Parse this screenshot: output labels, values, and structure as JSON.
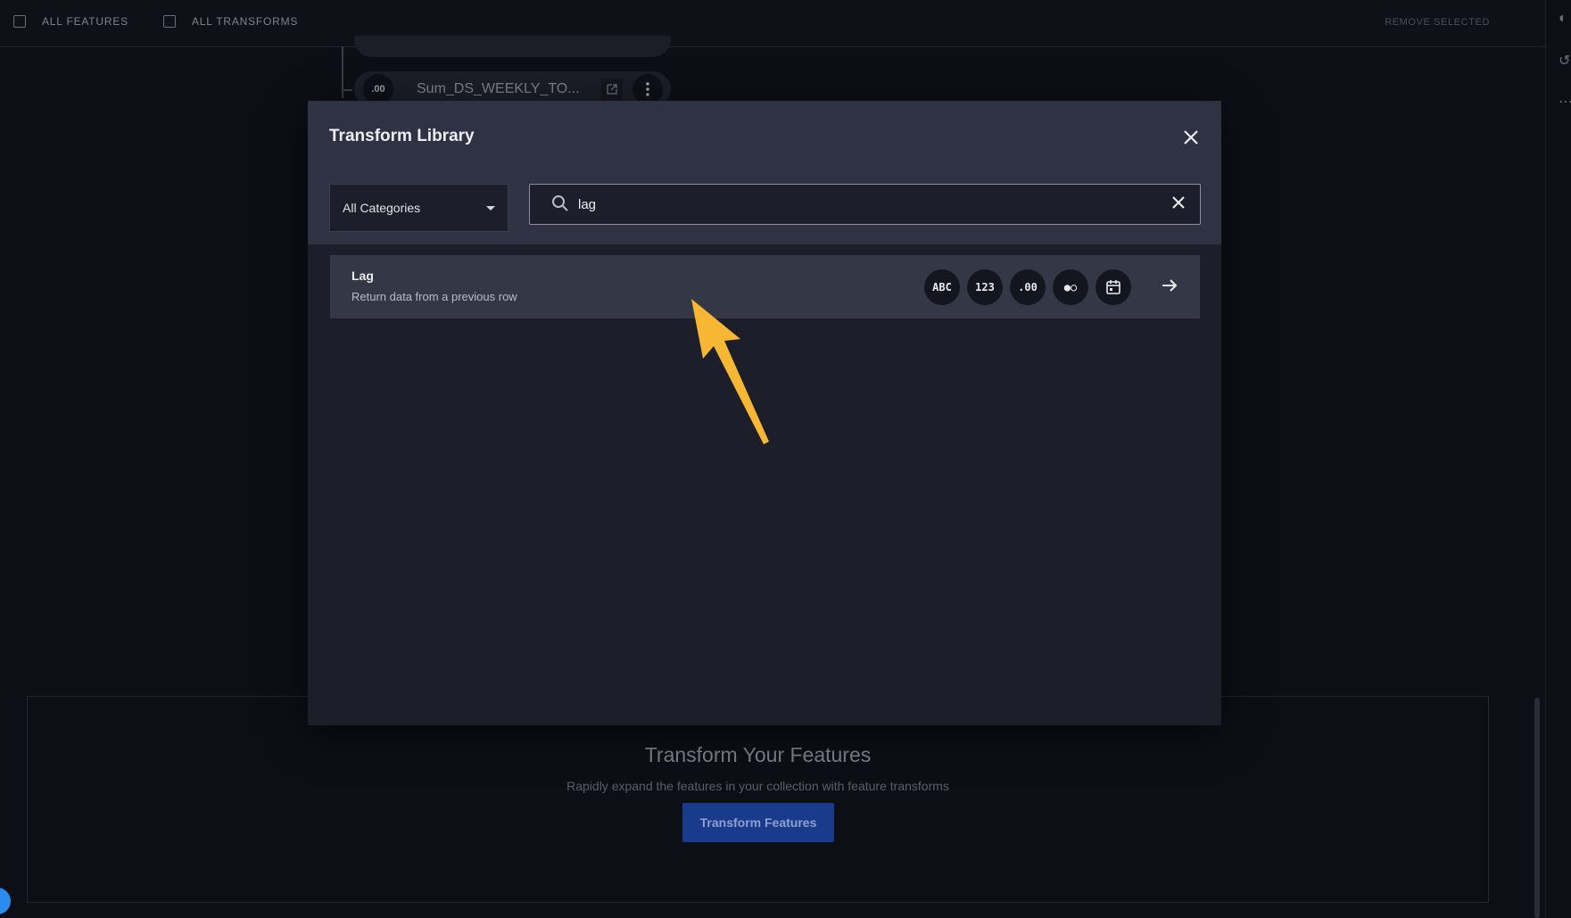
{
  "topbar": {
    "all_features": "ALL FEATURES",
    "all_transforms": "ALL TRANSFORMS",
    "remove_selected": "REMOVE SELECTED"
  },
  "feature_node": {
    "badge": ".00",
    "name": "Sum_DS_WEEKLY_TO..."
  },
  "cta": {
    "title": "Transform Your Features",
    "subtitle": "Rapidly expand the features in your collection with feature transforms",
    "button": "Transform Features"
  },
  "modal": {
    "title": "Transform Library",
    "category_selected": "All Categories",
    "search_value": "lag",
    "results": [
      {
        "name": "Lag",
        "description": "Return data from a previous row",
        "types": [
          "ABC",
          "123",
          ".00",
          "●○",
          "calendar-icon"
        ]
      }
    ]
  },
  "colors": {
    "accent_arrow": "#f7b733",
    "button_bg": "#1a3a8c",
    "modal_header": "#2f3242"
  }
}
